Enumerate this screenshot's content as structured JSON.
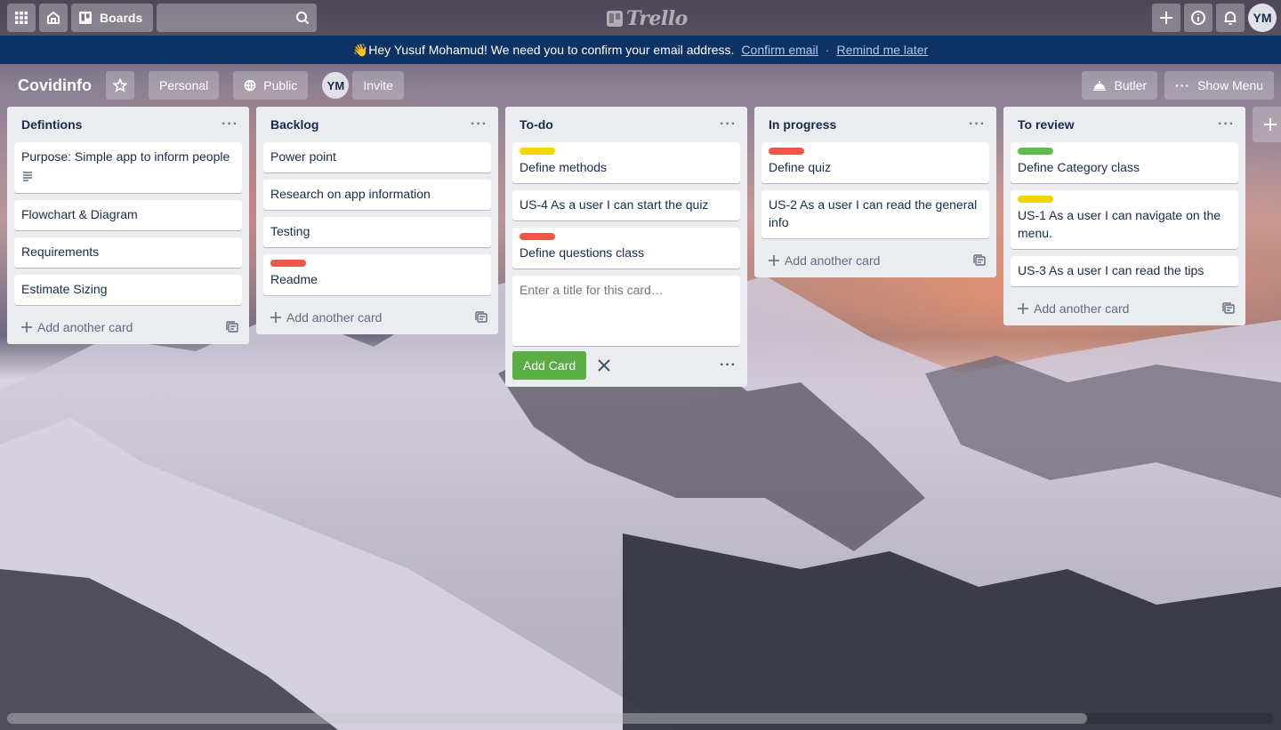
{
  "topnav": {
    "boards_label": "Boards",
    "search_placeholder": "",
    "logo_text": "Trello",
    "avatar_initials": "YM"
  },
  "banner": {
    "emoji": "👋",
    "message": "Hey Yusuf Mohamud! We need you to confirm your email address.",
    "confirm_link": "Confirm email",
    "separator": "·",
    "remind_link": "Remind me later"
  },
  "board": {
    "title": "Covidinfo",
    "personal_label": "Personal",
    "public_label": "Public",
    "member_initials": "YM",
    "invite_label": "Invite",
    "butler_label": "Butler",
    "show_menu_label": "Show Menu"
  },
  "lists": [
    {
      "title": "Defintions",
      "cards": [
        {
          "text": "Purpose: Simple app to inform people",
          "has_description": true
        },
        {
          "text": "Flowchart & Diagram"
        },
        {
          "text": "Requirements"
        },
        {
          "text": "Estimate Sizing"
        }
      ],
      "add_label": "Add another card"
    },
    {
      "title": "Backlog",
      "cards": [
        {
          "text": "Power point"
        },
        {
          "text": "Research on app information"
        },
        {
          "text": "Testing"
        },
        {
          "text": "Readme",
          "label": "red"
        }
      ],
      "add_label": "Add another card"
    },
    {
      "title": "To-do",
      "cards": [
        {
          "text": "Define methods",
          "label": "yellow"
        },
        {
          "text": "US-4 As a user I can start the quiz"
        },
        {
          "text": "Define questions class",
          "label": "red"
        }
      ],
      "composer": {
        "placeholder": "Enter a title for this card…",
        "add_button": "Add Card"
      }
    },
    {
      "title": "In progress",
      "cards": [
        {
          "text": "Define quiz",
          "label": "red"
        },
        {
          "text": "US-2 As a user I can read the general info"
        }
      ],
      "add_label": "Add another card"
    },
    {
      "title": "To review",
      "cards": [
        {
          "text": "Define Category class",
          "label": "green"
        },
        {
          "text": "US-1 As a user I can navigate on the menu.",
          "label": "yellow"
        },
        {
          "text": "US-3 As a user I can read the tips"
        }
      ],
      "add_label": "Add another card"
    }
  ],
  "colors": {
    "label_yellow": "#f2d600",
    "label_red": "#eb5a46",
    "label_green": "#61bd4f",
    "add_button": "#5aac44",
    "banner_bg": "#0d3366"
  },
  "icons": [
    "apps-icon",
    "home-icon",
    "boards-icon",
    "search-icon",
    "plus-icon",
    "info-icon",
    "bell-icon",
    "star-icon",
    "globe-icon",
    "butler-icon",
    "more-icon",
    "description-icon",
    "card-template-icon",
    "close-icon"
  ]
}
